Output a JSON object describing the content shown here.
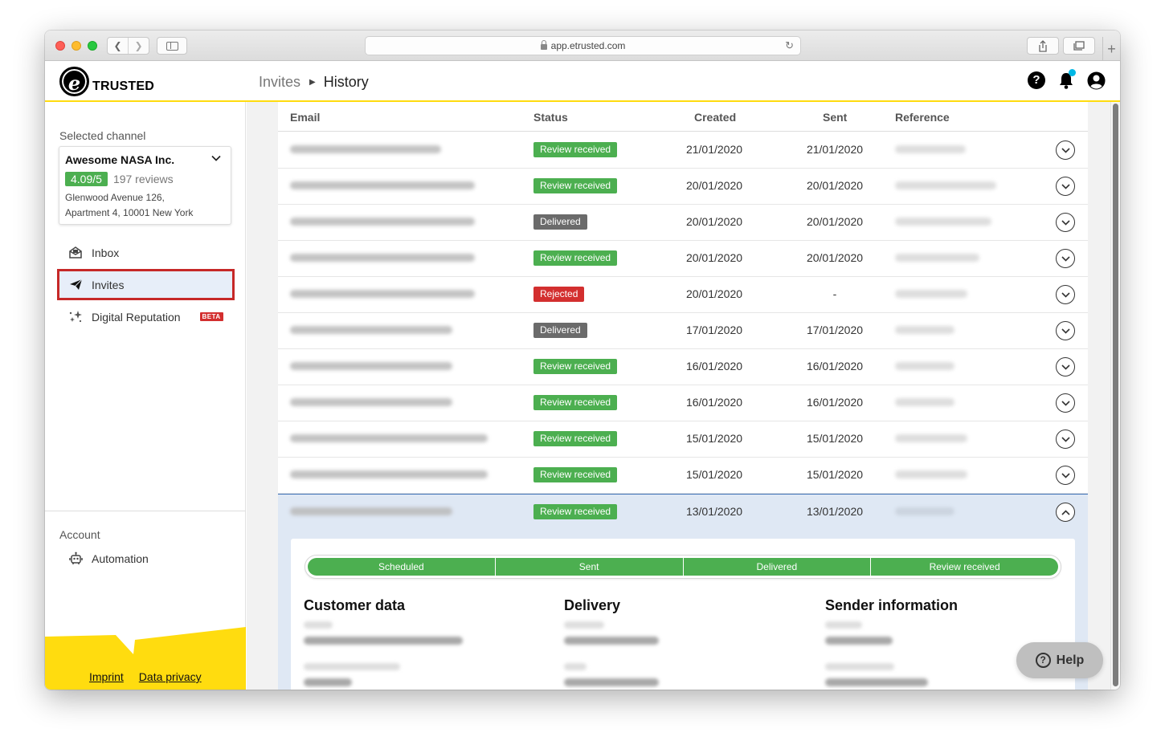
{
  "browser": {
    "url": "app.etrusted.com"
  },
  "header": {
    "logo_text": "TRUSTED",
    "logo_letter": "e",
    "breadcrumb": [
      "Invites",
      "History"
    ],
    "help_glyph": "?"
  },
  "sidebar": {
    "selected_channel_label": "Selected channel",
    "channel": {
      "name": "Awesome NASA Inc.",
      "rating": "4.09/5",
      "reviews": "197 reviews",
      "address_line1": "Glenwood Avenue 126,",
      "address_line2": "Apartment 4, 10001 New York"
    },
    "items": [
      {
        "label": "Inbox",
        "icon": "inbox-icon"
      },
      {
        "label": "Invites",
        "icon": "paper-plane-icon",
        "selected": true
      },
      {
        "label": "Digital Reputation",
        "icon": "sparkles-icon",
        "badge": "BETA"
      }
    ],
    "account_label": "Account",
    "account_items": [
      {
        "label": "Automation",
        "icon": "robot-icon"
      }
    ],
    "footer_links": [
      "Imprint",
      "Data privacy"
    ]
  },
  "table": {
    "columns": [
      "Email",
      "Status",
      "Created",
      "Sent",
      "Reference"
    ],
    "rows": [
      {
        "status": "Review received",
        "status_color": "green",
        "created": "21/01/2020",
        "sent": "21/01/2020"
      },
      {
        "status": "Review received",
        "status_color": "green",
        "created": "20/01/2020",
        "sent": "20/01/2020"
      },
      {
        "status": "Delivered",
        "status_color": "gray",
        "created": "20/01/2020",
        "sent": "20/01/2020"
      },
      {
        "status": "Review received",
        "status_color": "green",
        "created": "20/01/2020",
        "sent": "20/01/2020"
      },
      {
        "status": "Rejected",
        "status_color": "red",
        "created": "20/01/2020",
        "sent": "-"
      },
      {
        "status": "Delivered",
        "status_color": "gray",
        "created": "17/01/2020",
        "sent": "17/01/2020"
      },
      {
        "status": "Review received",
        "status_color": "green",
        "created": "16/01/2020",
        "sent": "16/01/2020"
      },
      {
        "status": "Review received",
        "status_color": "green",
        "created": "16/01/2020",
        "sent": "16/01/2020"
      },
      {
        "status": "Review received",
        "status_color": "green",
        "created": "15/01/2020",
        "sent": "15/01/2020"
      },
      {
        "status": "Review received",
        "status_color": "green",
        "created": "15/01/2020",
        "sent": "15/01/2020"
      },
      {
        "status": "Review received",
        "status_color": "green",
        "created": "13/01/2020",
        "sent": "13/01/2020",
        "expanded": true
      }
    ]
  },
  "detail": {
    "progress_steps": [
      "Scheduled",
      "Sent",
      "Delivered",
      "Review received"
    ],
    "sections": [
      "Customer data",
      "Delivery",
      "Sender information"
    ]
  },
  "help_button": {
    "label": "Help",
    "glyph": "?"
  },
  "colors": {
    "accent_yellow": "#ffdc0f",
    "status_green": "#4caf50",
    "status_gray": "#6b6b6b",
    "status_red": "#d32f2f",
    "selection_red": "#c62828"
  }
}
